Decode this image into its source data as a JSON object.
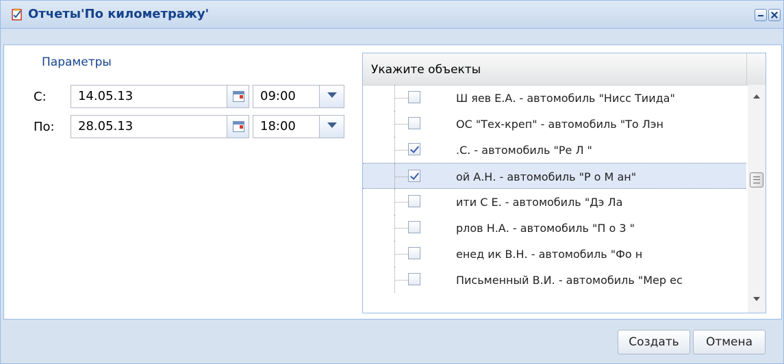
{
  "window": {
    "title": "Отчеты'По километражу'",
    "icon": "report-icon",
    "minimize_icon": "minimize-icon",
    "close_icon": "close-icon"
  },
  "params": {
    "legend": "Параметры",
    "from_label": "С:",
    "from_date": "14.05.13",
    "from_time": "09:00",
    "to_label": "По:",
    "to_date": "28.05.13",
    "to_time": "18:00"
  },
  "objects": {
    "header": "Укажите объекты",
    "rows": [
      {
        "text": "Ш    яев Е.А. - автомобиль \"Нисс    Тиида\"",
        "checked": false,
        "selected": false
      },
      {
        "text": "  ОС  \"Тех-креп\" - автомобиль \"То      Лэн",
        "checked": false,
        "selected": false
      },
      {
        "text": "        .С. - автомобиль \"Ре   Л   \"",
        "checked": true,
        "selected": false
      },
      {
        "text": "      ой А.Н. - автомобиль \"Р   о М   ан\"",
        "checked": true,
        "selected": true
      },
      {
        "text": "ити  С Е. - автомобиль \"Дэ  Ла",
        "checked": false,
        "selected": false
      },
      {
        "text": "рлов  Н.А. - автомобиль \"П    о 3   \"",
        "checked": false,
        "selected": false
      },
      {
        "text": "енед  ик В.Н. - автомобиль \"Фо       н",
        "checked": false,
        "selected": false
      },
      {
        "text": "Письменный В.И. - автомобиль \"Мер   ес",
        "checked": false,
        "selected": false
      }
    ]
  },
  "buttons": {
    "create": "Создать",
    "cancel": "Отмена"
  },
  "colors": {
    "accent": "#15428b",
    "border": "#99bbe8",
    "window_bg": "#d6e2f0"
  }
}
